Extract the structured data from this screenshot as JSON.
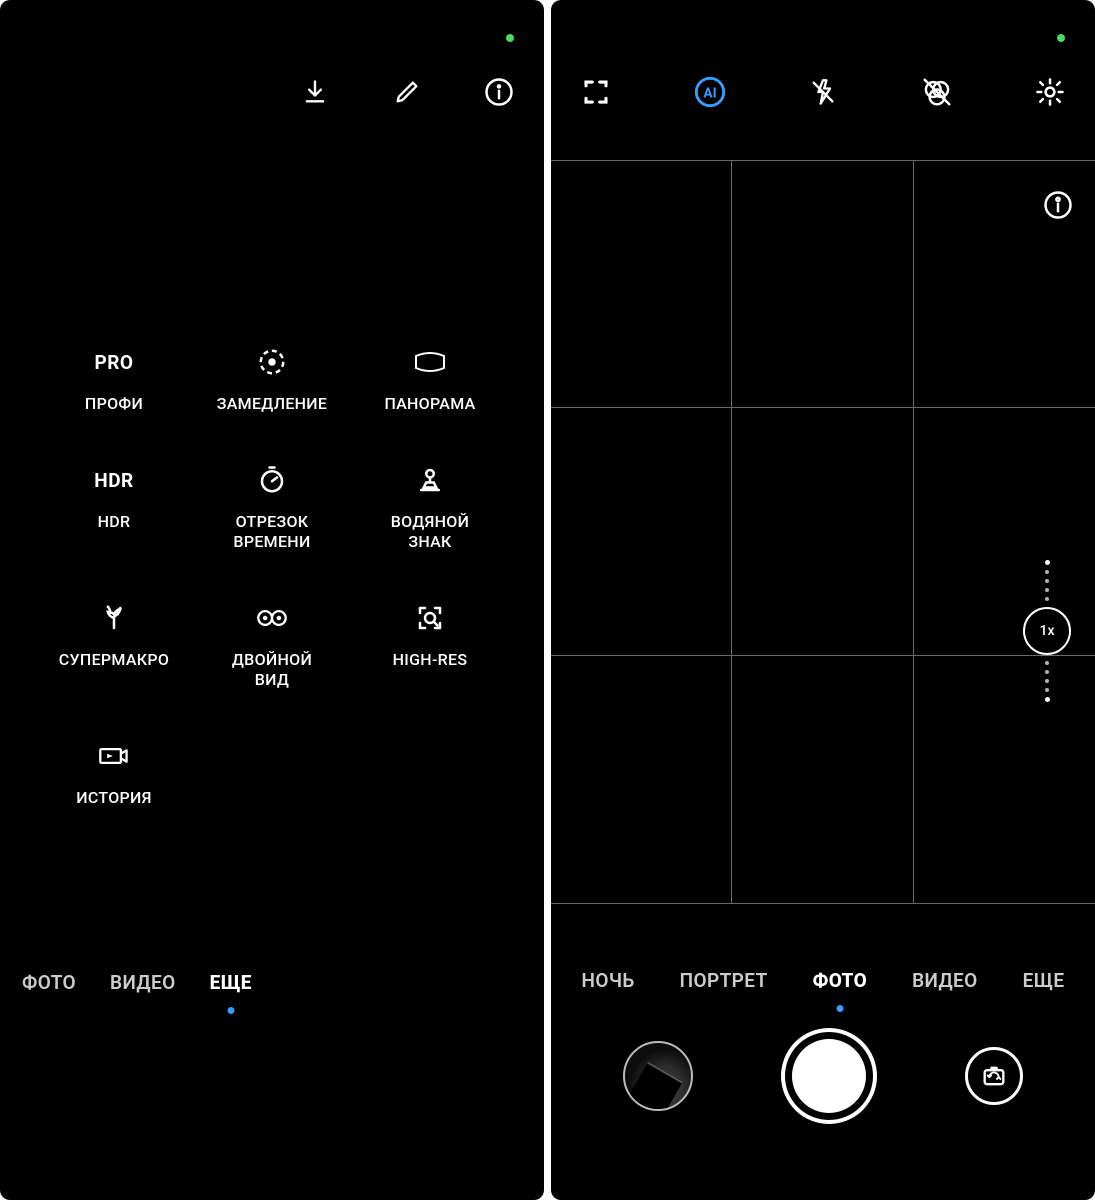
{
  "left": {
    "topbar_icons": [
      "download-icon",
      "edit-icon",
      "info-icon"
    ],
    "modes": [
      {
        "icon": "PRO",
        "icon_type": "text",
        "label": "ПРОФИ"
      },
      {
        "icon": "slowmo-icon",
        "label": "ЗАМЕДЛЕНИЕ"
      },
      {
        "icon": "panorama-icon",
        "label": "ПАНОРАМА"
      },
      {
        "icon": "HDR",
        "icon_type": "text",
        "label": "HDR"
      },
      {
        "icon": "timer-icon",
        "label": "ОТРЕЗОК\nВРЕМЕНИ"
      },
      {
        "icon": "stamp-icon",
        "label": "ВОДЯНОЙ\nЗНАК"
      },
      {
        "icon": "macro-icon",
        "label": "СУПЕРМАКРО"
      },
      {
        "icon": "dualview-icon",
        "label": "ДВОЙНОЙ\nВИД"
      },
      {
        "icon": "highres-icon",
        "label": "HIGH-RES"
      },
      {
        "icon": "story-icon",
        "label": "ИСТОРИЯ"
      }
    ],
    "tabs": [
      {
        "label": "ФОТО",
        "active": false
      },
      {
        "label": "ВИДЕО",
        "active": false
      },
      {
        "label": "ЕЩЕ",
        "active": true
      }
    ]
  },
  "right": {
    "topbar_icons": [
      "scan-icon",
      "ai-icon",
      "flash-off-icon",
      "filter-off-icon",
      "settings-icon"
    ],
    "viewfinder_info_icon": "info-icon",
    "zoom": {
      "level": "1x"
    },
    "tabs": [
      {
        "label": "НОЧЬ",
        "active": false
      },
      {
        "label": "ПОРТРЕТ",
        "active": false
      },
      {
        "label": "ФОТО",
        "active": true
      },
      {
        "label": "ВИДЕО",
        "active": false
      },
      {
        "label": "ЕЩЕ",
        "active": false
      }
    ],
    "controls": {
      "thumbnail": "gallery-thumbnail",
      "shutter": "shutter-button",
      "switch": "switch-camera-button"
    }
  },
  "colors": {
    "accent": "#3a9bff",
    "status_dot": "#4cd964"
  }
}
